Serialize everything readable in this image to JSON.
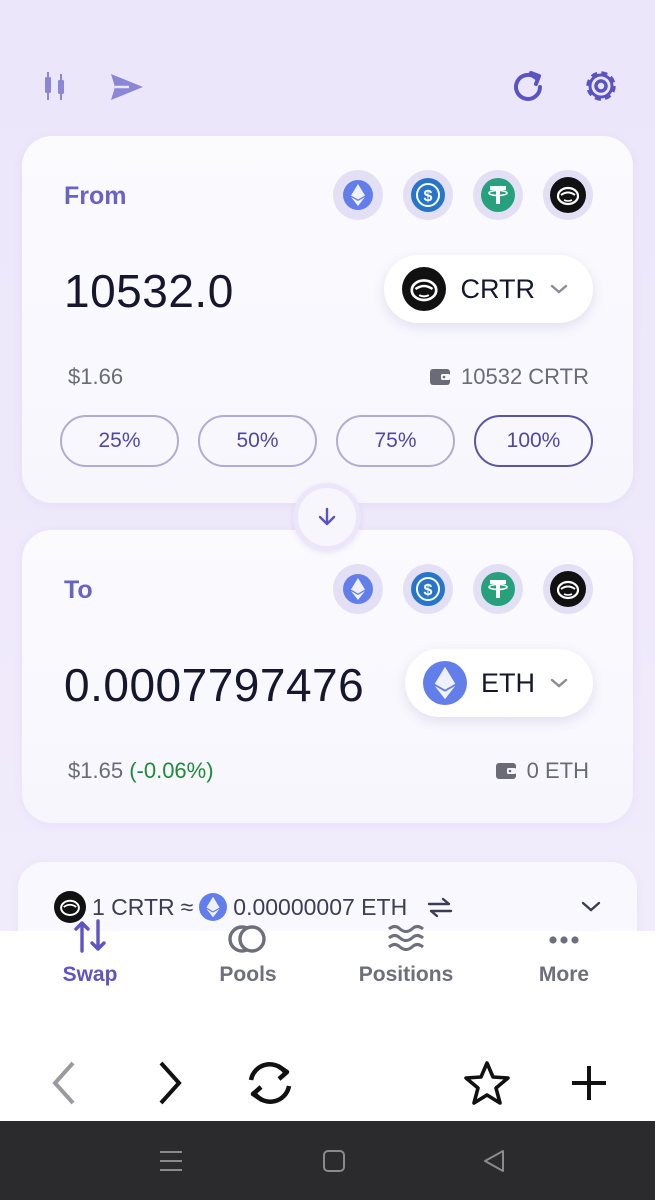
{
  "toolbar": {
    "icons": [
      "candlestick-chart-icon",
      "send-icon",
      "refresh-icon",
      "settings-gear-icon"
    ],
    "accent_color": "#5a54c2"
  },
  "from": {
    "label": "From",
    "amount": "10532.0",
    "token_symbol": "CRTR",
    "usd_value": "$1.66",
    "balance": "10532 CRTR",
    "quick_tokens": [
      "eth",
      "usdc",
      "usdt",
      "crtr"
    ],
    "percent_buttons": [
      "25%",
      "50%",
      "75%",
      "100%"
    ]
  },
  "to": {
    "label": "To",
    "amount": "0.0007797476",
    "token_symbol": "ETH",
    "usd_value": "$1.65",
    "price_impact": "(-0.06%)",
    "balance": "0 ETH",
    "quick_tokens": [
      "eth",
      "usdc",
      "usdt",
      "crtr"
    ]
  },
  "rate": {
    "left": "1 CRTR",
    "approx": "≈",
    "right": "0.00000007 ETH"
  },
  "bottom_nav": {
    "items": [
      {
        "label": "Swap",
        "icon": "swap-arrows-icon",
        "active": true
      },
      {
        "label": "Pools",
        "icon": "pools-icon",
        "active": false
      },
      {
        "label": "Positions",
        "icon": "waves-icon",
        "active": false
      },
      {
        "label": "More",
        "icon": "more-dots-icon",
        "active": false
      }
    ]
  },
  "colors": {
    "brand": "#6a62c5",
    "positive": "#1f8a3b",
    "eth": "#627eea",
    "usdc": "#2775ca",
    "usdt": "#26a17b"
  }
}
